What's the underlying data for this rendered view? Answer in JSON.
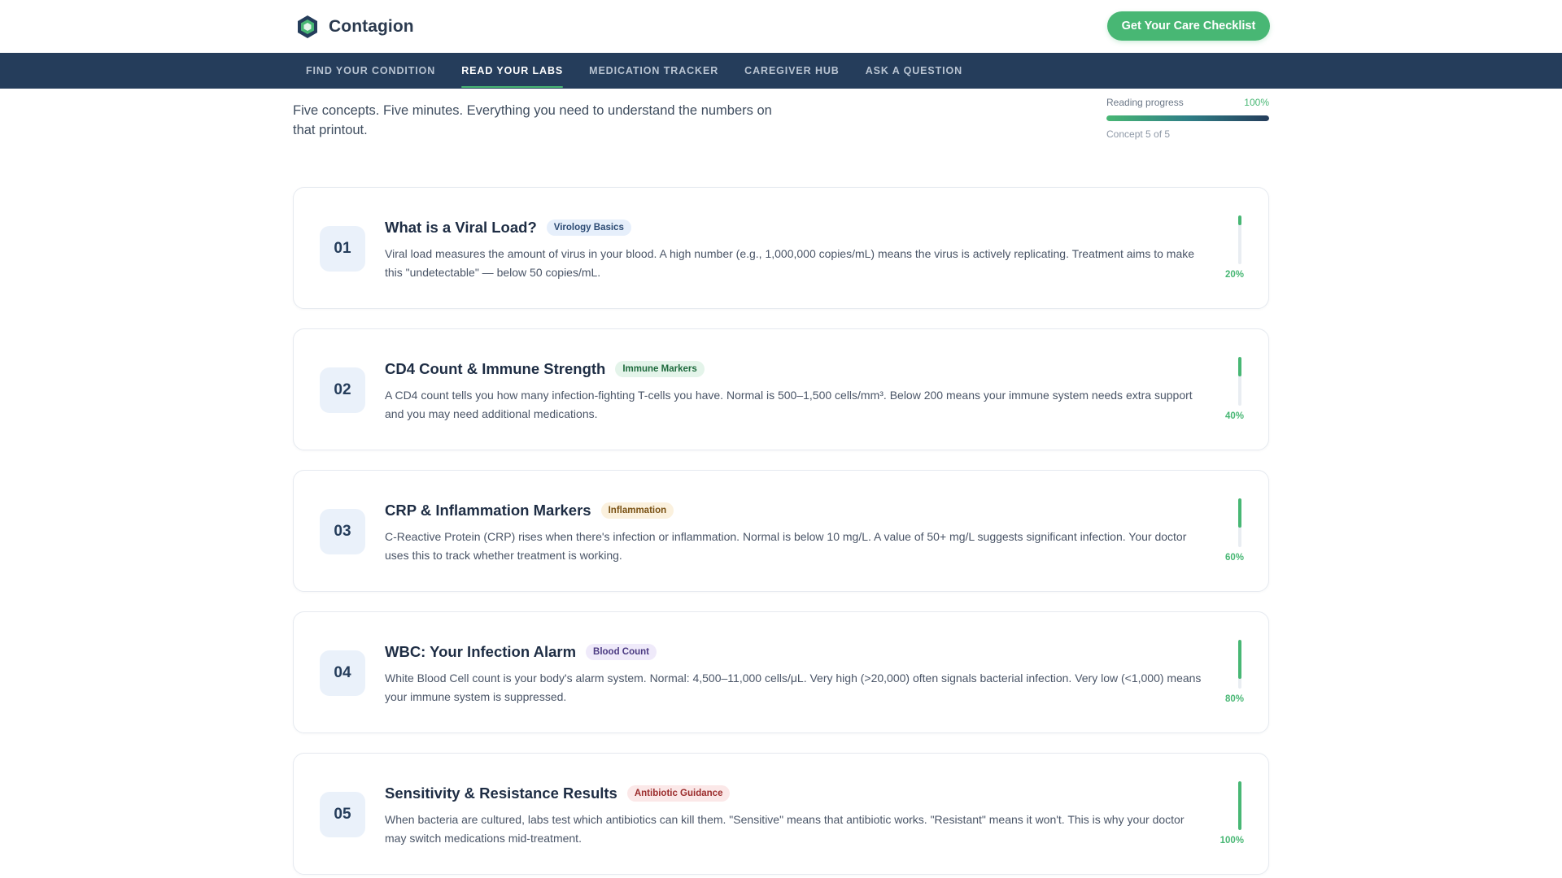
{
  "header": {
    "brand_name": "Contagion",
    "logo_icon": "hexagon-shield-icon",
    "cta_label": "Get Your Care Checklist"
  },
  "nav": {
    "items": [
      {
        "label": "FIND YOUR CONDITION",
        "active": false
      },
      {
        "label": "READ YOUR LABS",
        "active": true
      },
      {
        "label": "MEDICATION TRACKER",
        "active": false
      },
      {
        "label": "CAREGIVER HUB",
        "active": false
      },
      {
        "label": "ASK A QUESTION",
        "active": false
      }
    ]
  },
  "intro": {
    "text": "Five concepts. Five minutes. Everything you need to understand the numbers on that printout."
  },
  "progress": {
    "label": "Reading progress",
    "value_text": "100%",
    "fraction": 1.0,
    "sub": "Concept 5 of 5"
  },
  "colors": {
    "accent_green": "#48b774",
    "navy": "#253d5b"
  },
  "concepts": [
    {
      "number": "01",
      "title": "What is a Viral Load?",
      "tag": "Virology Basics",
      "tag_bg": "#e6effb",
      "tag_color": "#2b4a73",
      "description": "Viral load measures the amount of virus in your blood. A high number (e.g., 1,000,000 copies/mL) means the virus is actively replicating. Treatment aims to make this \"undetectable\" — below 50 copies/mL.",
      "progress_text": "20%",
      "progress_fraction": 0.2
    },
    {
      "number": "02",
      "title": "CD4 Count & Immune Strength",
      "tag": "Immune Markers",
      "tag_bg": "#e4f4ea",
      "tag_color": "#1f6b3e",
      "description": "A CD4 count tells you how many infection-fighting T-cells you have. Normal is 500–1,500 cells/mm³. Below 200 means your immune system needs extra support and you may need additional medications.",
      "progress_text": "40%",
      "progress_fraction": 0.4
    },
    {
      "number": "03",
      "title": "CRP & Inflammation Markers",
      "tag": "Inflammation",
      "tag_bg": "#fbf1de",
      "tag_color": "#7a5214",
      "description": "C-Reactive Protein (CRP) rises when there's infection or inflammation. Normal is below 10 mg/L. A value of 50+ mg/L suggests significant infection. Your doctor uses this to track whether treatment is working.",
      "progress_text": "60%",
      "progress_fraction": 0.6
    },
    {
      "number": "04",
      "title": "WBC: Your Infection Alarm",
      "tag": "Blood Count",
      "tag_bg": "#efeafa",
      "tag_color": "#4b3a82",
      "description": "White Blood Cell count is your body's alarm system. Normal: 4,500–11,000 cells/μL. Very high (>20,000) often signals bacterial infection. Very low (<1,000) means your immune system is suppressed.",
      "progress_text": "80%",
      "progress_fraction": 0.8
    },
    {
      "number": "05",
      "title": "Sensitivity & Resistance Results",
      "tag": "Antibiotic Guidance",
      "tag_bg": "#fbe8e8",
      "tag_color": "#9b2c2c",
      "description": "When bacteria are cultured, labs test which antibiotics can kill them. \"Sensitive\" means that antibiotic works. \"Resistant\" means it won't. This is why your doctor may switch medications mid-treatment.",
      "progress_text": "100%",
      "progress_fraction": 1.0
    }
  ]
}
